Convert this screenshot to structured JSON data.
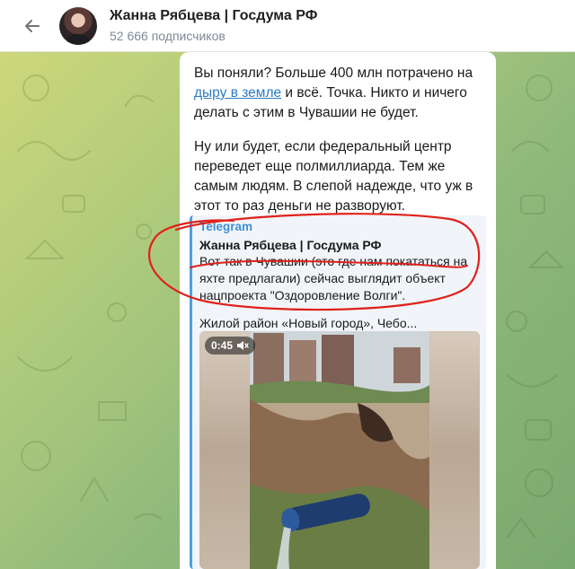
{
  "header": {
    "back_icon": "arrow-left-icon",
    "title": "Жанна Рябцева | Госдума РФ",
    "subscribers": "52 666 подписчиков"
  },
  "message": {
    "p1_before": "Вы поняли? Больше 400 млн потрачено на ",
    "p1_link": "дыру в земле",
    "p1_after": " и всё. Точка. Никто и ничего делать с этим в Чувашии не будет.",
    "p2": "Ну или будет, если федеральный центр переведет еще полмиллиарда. Тем же самым людям. В слепой надежде, что уж в этот то раз деньги не разворуют."
  },
  "quote": {
    "source": "Telegram",
    "author": "Жанна Рябцева | Госдума РФ",
    "text": "Вот так в Чувашии (это где нам покататься на яхте предлагали) сейчас выглядит объект нацпроекта \"Оздоровление Волги\".",
    "caption": "Жилой район «Новый город», Чебо..."
  },
  "video": {
    "duration": "0:45",
    "mute_icon": "speaker-muted-icon"
  },
  "colors": {
    "link": "#2c7bc4",
    "quote_accent": "#4f9fe0",
    "annotation": "#e0201b"
  }
}
